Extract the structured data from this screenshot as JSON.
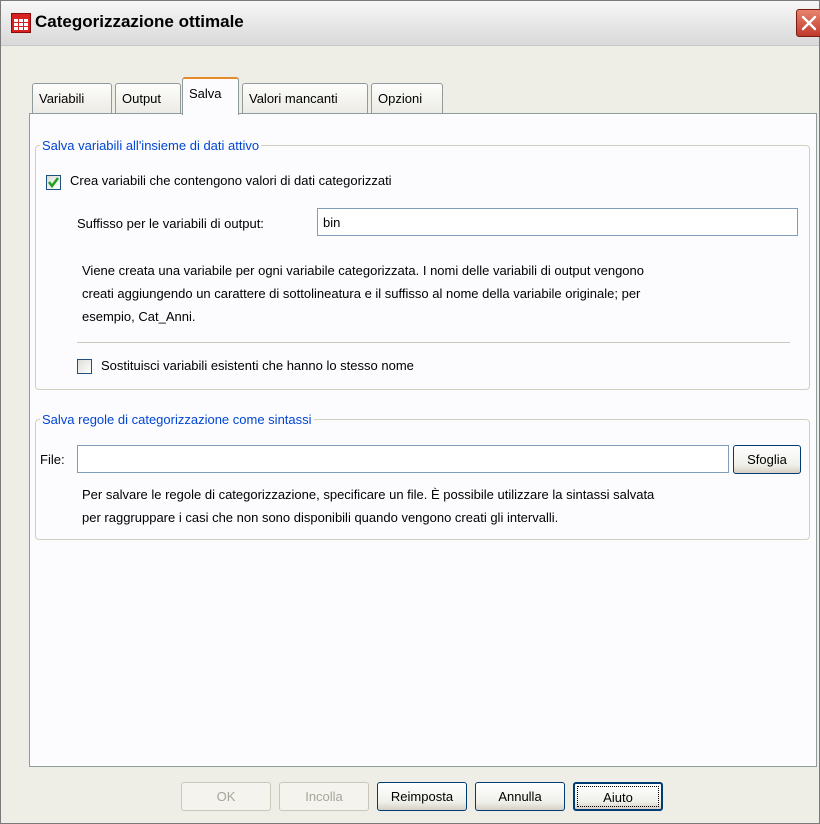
{
  "window": {
    "title": "Categorizzazione ottimale",
    "close_label": "×"
  },
  "tabs": [
    {
      "label": "Variabili",
      "active": false
    },
    {
      "label": "Output",
      "active": false
    },
    {
      "label": "Salva",
      "active": true
    },
    {
      "label": "Valori mancanti",
      "active": false
    },
    {
      "label": "Opzioni",
      "active": false
    }
  ],
  "save_vars_group": {
    "legend": "Salva variabili all'insieme di dati attivo",
    "create_checkbox": {
      "label": "Crea variabili che contengono valori di dati categorizzati",
      "checked": true
    },
    "suffix_label": "Suffisso per le variabili di output:",
    "suffix_value": "bin",
    "description_lines": [
      "Viene creata una variabile per ogni variabile categorizzata. I nomi delle variabili di output vengono",
      "creati aggiungendo un carattere di sottolineatura e il suffisso al nome della variabile originale; per",
      "esempio, Cat_Anni."
    ],
    "replace_checkbox": {
      "label": "Sostituisci variabili esistenti che hanno lo stesso nome",
      "checked": false
    }
  },
  "save_rules_group": {
    "legend": "Salva regole di categorizzazione come sintassi",
    "file_label": "File:",
    "file_value": "",
    "browse_label": "Sfoglia",
    "description_lines": [
      "Per salvare le regole di categorizzazione, specificare un file. È possibile utilizzare la sintassi salvata",
      "per raggruppare i casi che non sono disponibili quando vengono creati gli intervalli."
    ]
  },
  "buttons": {
    "ok": "OK",
    "paste": "Incolla",
    "reset": "Reimposta",
    "cancel": "Annulla",
    "help": "Aiuto"
  }
}
